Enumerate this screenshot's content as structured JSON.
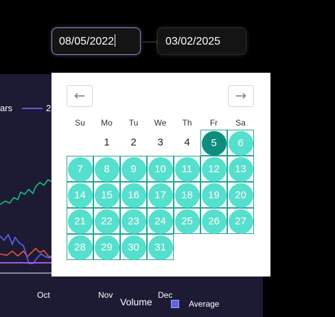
{
  "date_range": {
    "start_value": "08/05/2022",
    "end_value": "03/02/2025"
  },
  "calendar": {
    "prev_icon": "arrow-left-icon",
    "next_icon": "arrow-right-icon",
    "weekdays": [
      "Su",
      "Mo",
      "Tu",
      "We",
      "Th",
      "Fr",
      "Sa"
    ],
    "days": [
      "1",
      "2",
      "3",
      "4",
      "5",
      "6",
      "7",
      "8",
      "9",
      "10",
      "11",
      "12",
      "13",
      "14",
      "15",
      "16",
      "17",
      "18",
      "19",
      "20",
      "21",
      "22",
      "23",
      "24",
      "25",
      "26",
      "27",
      "28",
      "29",
      "30",
      "31"
    ],
    "first_weekday_index": 1,
    "plain_days": [
      "1",
      "2",
      "3",
      "4"
    ],
    "selected_day": "5",
    "range_color": "#48dcc8",
    "selected_color": "#108c7f"
  },
  "chart": {
    "legend": [
      {
        "label": "ars",
        "color": "#e45a3a"
      },
      {
        "label": "2",
        "color": "#5b5be8"
      }
    ],
    "months": [
      "Oct",
      "Nov",
      "Dec"
    ],
    "volume_label": "Volume",
    "average_label": "Average",
    "colors": {
      "green": "#1bbf83",
      "red": "#e8573a",
      "blue": "#5b5be8",
      "purple": "#a35be0"
    }
  }
}
